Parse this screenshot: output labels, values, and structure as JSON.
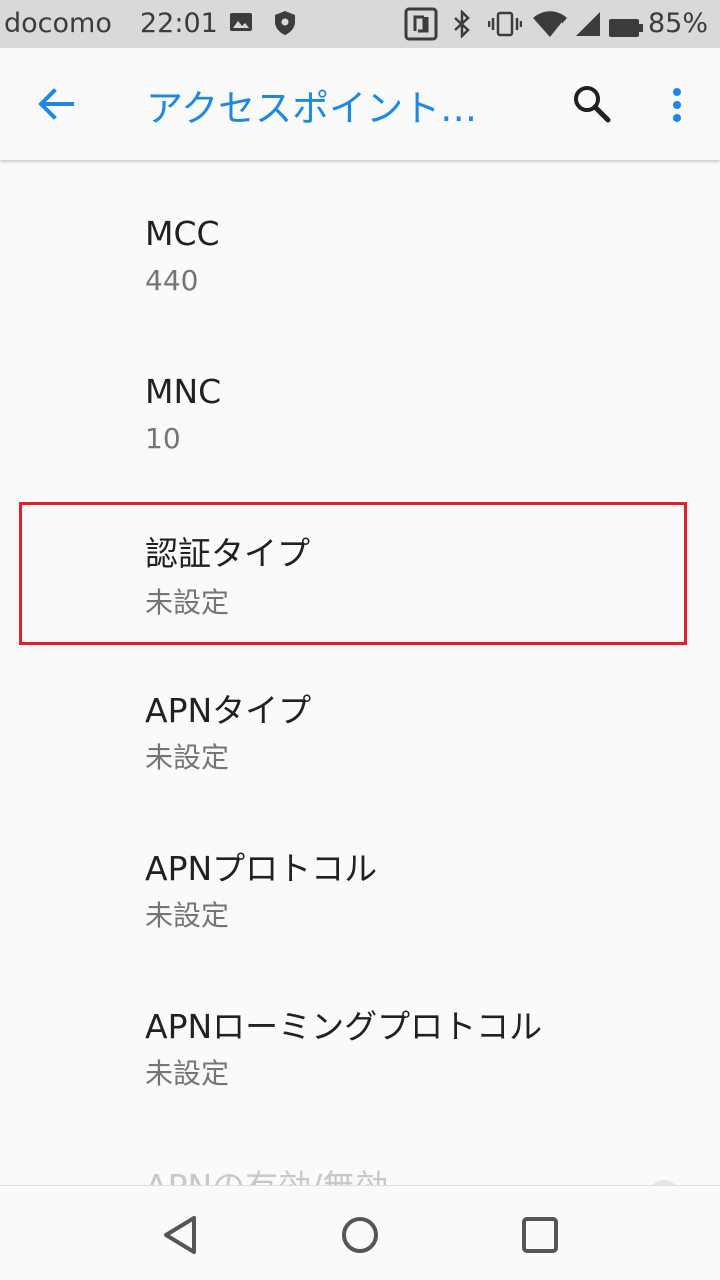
{
  "status_bar": {
    "carrier": "docomo",
    "time": "22:01",
    "battery_percent": "85%",
    "icons": [
      "gallery-icon",
      "shield-icon",
      "nfc-icon",
      "bluetooth-icon",
      "vibrate-icon",
      "wifi-icon",
      "battery-icon"
    ]
  },
  "app_bar": {
    "title": "アクセスポイント…",
    "accent_color": "#1e88e5"
  },
  "items": [
    {
      "label": "MCC",
      "value": "440"
    },
    {
      "label": "MNC",
      "value": "10"
    },
    {
      "label": "認証タイプ",
      "value": "未設定"
    },
    {
      "label": "APNタイプ",
      "value": "未設定"
    },
    {
      "label": "APNプロトコル",
      "value": "未設定"
    },
    {
      "label": "APNローミングプロトコル",
      "value": "未設定"
    },
    {
      "label": "APNの有効/無効"
    }
  ],
  "highlight_color": "#e0202a",
  "nav_bar": {
    "icons": [
      "back-triangle-icon",
      "home-circle-icon",
      "recents-square-icon"
    ]
  }
}
